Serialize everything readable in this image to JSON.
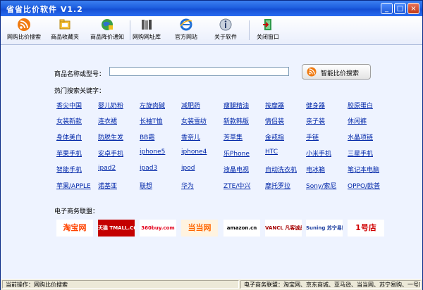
{
  "window": {
    "title": "省省比价软件 V1.2",
    "controls": [
      "_",
      "□",
      "×"
    ]
  },
  "toolbar": {
    "items": [
      {
        "label": "网购比价搜索",
        "icon": "rss-search-icon"
      },
      {
        "label": "商品收藏夹",
        "icon": "folder-icon"
      },
      {
        "label": "商品降价通知",
        "icon": "globe-notice-icon"
      },
      {
        "label": "网购网址库",
        "icon": "books-icon"
      },
      {
        "label": "官方网站",
        "icon": "ie-browser-icon"
      },
      {
        "label": "关于软件",
        "icon": "info-icon"
      },
      {
        "label": "关闭窗口",
        "icon": "exit-door-icon"
      }
    ]
  },
  "search": {
    "label": "商品名称或型号：",
    "value": "",
    "placeholder": "",
    "button_label": "智能比价搜索"
  },
  "hot_keywords": {
    "label": "热门搜索关键字：",
    "rows": [
      [
        "香尖中国",
        "婴儿奶粉",
        "左旋肉碱",
        "减肥药",
        "瘦腿精油",
        "按摩器",
        "健身器",
        "胶原蛋白"
      ],
      [
        "女装新款",
        "连衣裙",
        "长袖T恤",
        "女装雪纺",
        "新款韩版",
        "情侣装",
        "亲子装",
        "休闲裤"
      ],
      [
        "身体美白",
        "防脱生发",
        "BB霜",
        "香奈儿",
        "芳草集",
        "金戒指",
        "手链",
        "水晶项链"
      ],
      [
        "苹果手机",
        "安卓手机",
        "iphone5",
        "iphone4",
        "乐Phone",
        "HTC",
        "小米手机",
        "三星手机"
      ],
      [
        "智能手机",
        "ipad2",
        "ipad3",
        "ipod",
        "液晶电视",
        "自动洗衣机",
        "电冰箱",
        "笔记本电脑"
      ],
      [
        "苹果/APPLE",
        "诺基亚",
        "联想",
        "华为",
        "ZTE/中兴",
        "摩托罗拉",
        "Sony/索尼",
        "OPPO/欧普"
      ]
    ]
  },
  "ecommerce": {
    "label": "电子商务联盟：",
    "logos": [
      {
        "text": "淘宝网",
        "color": "#ff4400"
      },
      {
        "text": "天猫 TMALL.COM",
        "color": "#c40000"
      },
      {
        "text": "360buy.com",
        "color": "#e3001b"
      },
      {
        "text": "当当网",
        "color": "#ff6600"
      },
      {
        "text": "amazon.cn",
        "color": "#000000"
      },
      {
        "text": "VANCL 凡客诚品",
        "color": "#a50000"
      },
      {
        "text": "Suning 苏宁易购",
        "color": "#1a3c9e"
      },
      {
        "text": "1号店",
        "color": "#d00000"
      }
    ]
  },
  "statusbar": {
    "current": "当前操作：网购比价搜索",
    "union": "电子商务联盟：淘宝网、京东商城、亚马逊、当当网、苏宁易购、一号店......"
  },
  "colors": {
    "title_bar": "#1e5fe0",
    "link": "#0026a8",
    "content_bg": "#eef3ff"
  }
}
